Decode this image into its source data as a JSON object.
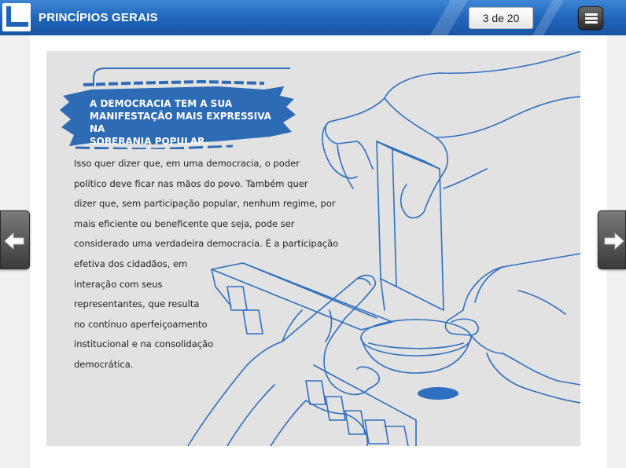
{
  "header": {
    "title": "PRINCÍPIOS GERAIS",
    "page_counter": "3 de 20",
    "menu_icon": "hamburger-menu-icon",
    "logo_icon": "l-shape-logo-icon"
  },
  "slide": {
    "banner_text": [
      "A DEMOCRACIA TEM A SUA",
      "MANIFESTAÇÃO MAIS EXPRESSIVA NA",
      "SOBERANIA POPULAR."
    ],
    "paragraph_lines": [
      "Isso quer dizer que, em uma democracia, o poder",
      "político deve ficar nas mãos do povo. Também quer",
      "dizer que, sem participação popular, nenhum regime, por",
      "mais eficiente ou beneficente que seja, pode ser",
      "considerado uma verdadeira democracia.  É a participação"
    ],
    "paragraph_lines_narrow": [
      "efetiva dos cidadãos, em",
      "interação com seus",
      "representantes, que resulta",
      "no contínuo aperfeiçoamento",
      "institucional e na consolidação",
      "democrática."
    ],
    "illustration": "hands-voting-ballot-box-illustration"
  },
  "navigation": {
    "prev_icon": "arrow-left-icon",
    "next_icon": "arrow-right-icon"
  },
  "colors": {
    "header_blue": "#1f64b8",
    "banner_blue": "#2e6bb5",
    "illustration_line": "#2f6fc0",
    "illustration_bg": "#e2e2e2"
  }
}
